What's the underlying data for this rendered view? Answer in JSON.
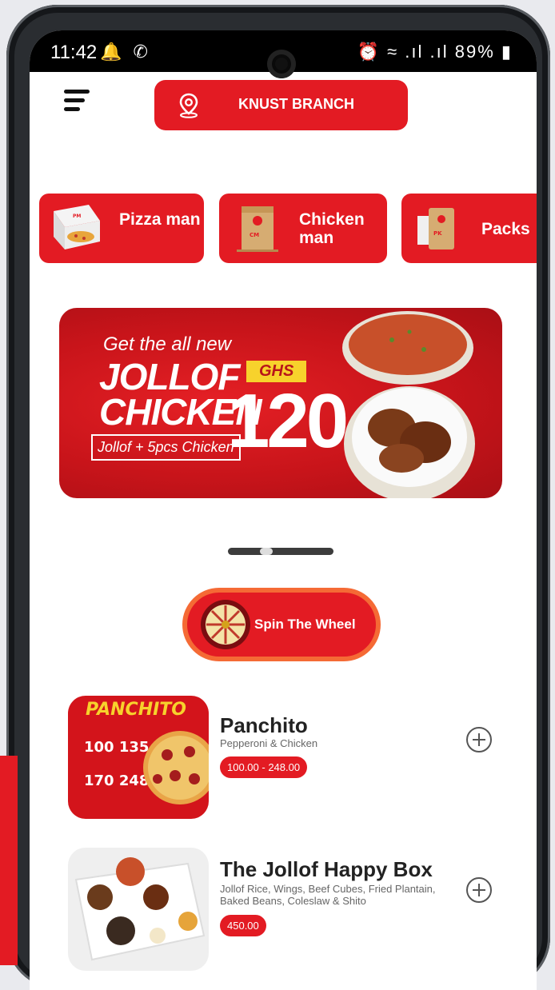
{
  "status_bar": {
    "time": "11:42",
    "left_icons": "🔔 ✆",
    "right_icons": "⏰ ≈ .ıl .ıl",
    "battery": "89%"
  },
  "header": {
    "branch_label": "KNUST BRANCH"
  },
  "categories": [
    {
      "label": "Pizza man"
    },
    {
      "label": "Chicken man"
    },
    {
      "label": "Packs"
    }
  ],
  "banner": {
    "small": "Get the all new",
    "title_line1": "JOLLOF",
    "title_line2": "CHICKEN",
    "currency": "GHS",
    "price": "120",
    "subline": "Jollof + 5pcs Chicken"
  },
  "spin": {
    "label": "Spin The Wheel"
  },
  "menu_items": [
    {
      "name": "Panchito",
      "description": "Pepperoni & Chicken",
      "price": "100.00 - 248.00"
    },
    {
      "name": "The Jollof Happy Box",
      "description": "Jollof Rice, Wings, Beef Cubes, Fried Plantain, Baked Beans, Coleslaw & Shito",
      "price": "450.00"
    }
  ],
  "colors": {
    "brand_red": "#e31b23",
    "spin_orange": "#f56a35"
  }
}
